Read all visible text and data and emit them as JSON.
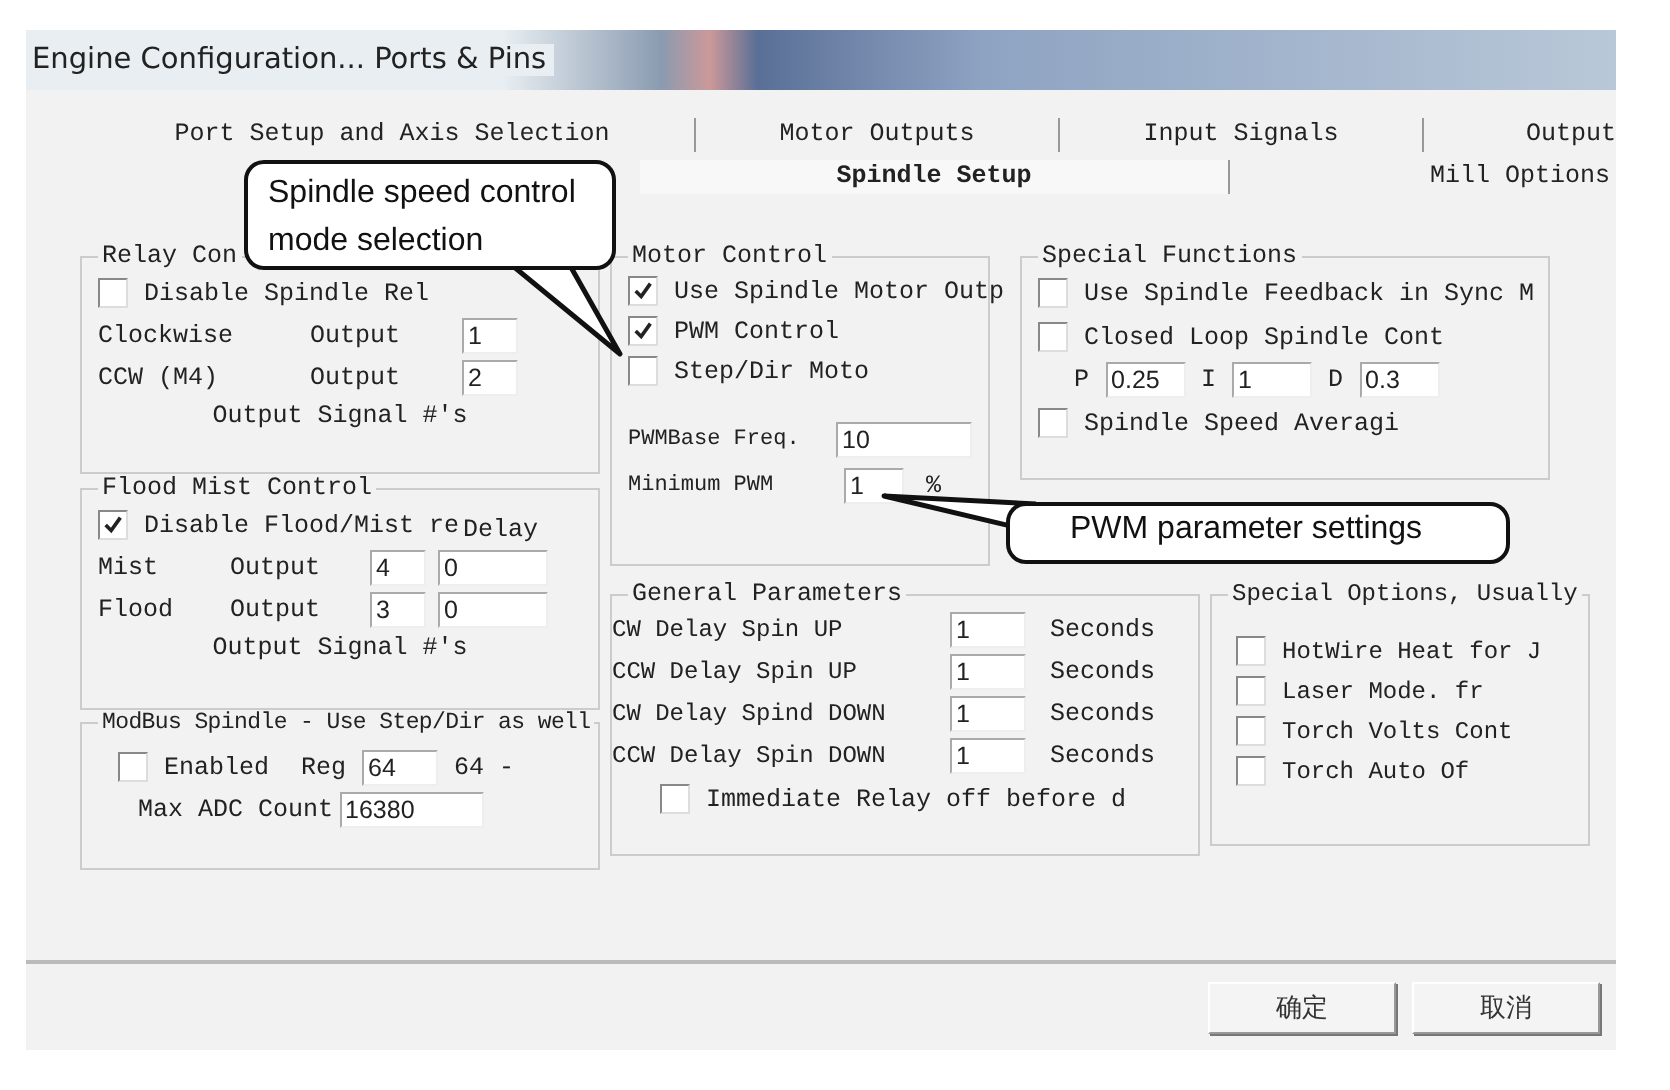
{
  "window": {
    "title": "Engine Configuration... Ports & Pins"
  },
  "tabs": [
    [
      {
        "label": "Port Setup and Axis Selection",
        "selected": false
      },
      {
        "label": "Motor Outputs",
        "selected": false
      },
      {
        "label": "Input Signals",
        "selected": false
      },
      {
        "label": "Output",
        "selected": false
      }
    ],
    [
      {
        "label": "Spindle Setup",
        "selected": true
      },
      {
        "label": "Mill Options",
        "selected": false
      }
    ]
  ],
  "relay_control": {
    "title": "Relay Con",
    "disable": {
      "label": "Disable Spindle Rel",
      "checked": false
    },
    "outputs": [
      {
        "name": "Clockwise",
        "label": "Output",
        "value": "1"
      },
      {
        "name": "CCW (M4)",
        "label": "Output",
        "value": "2"
      }
    ],
    "footer": "Output Signal #'s"
  },
  "flood_mist": {
    "title": "Flood Mist Control",
    "disable": {
      "label": "Disable Flood/Mist re",
      "checked": true
    },
    "delay_heading": "Delay",
    "outputs": [
      {
        "name": "Mist",
        "label": "Output",
        "value": "4",
        "delay": "0"
      },
      {
        "name": "Flood",
        "label": "Output",
        "value": "3",
        "delay": "0"
      }
    ],
    "footer": "Output Signal #'s"
  },
  "modbus": {
    "title": "ModBus Spindle - Use Step/Dir as well",
    "enabled": {
      "label": "Enabled",
      "checked": false
    },
    "reg_label": "Reg",
    "reg_value": "64",
    "reg_suffix": "64 -",
    "max_adc_label": "Max ADC Count",
    "max_adc_value": "16380"
  },
  "motor_control": {
    "title": "Motor Control",
    "options": [
      {
        "label": "Use Spindle Motor Outp",
        "checked": true
      },
      {
        "label": "PWM Control",
        "checked": true
      },
      {
        "label": "Step/Dir Moto",
        "checked": false
      }
    ],
    "fields": [
      {
        "label": "PWMBase Freq.",
        "value": "10"
      },
      {
        "label": "Minimum PWM",
        "value": "1",
        "unit": "%"
      }
    ]
  },
  "special_functions": {
    "title": "Special Functions",
    "options": [
      {
        "label": "Use Spindle Feedback in Sync M",
        "checked": false
      },
      {
        "label": "Closed Loop Spindle Cont",
        "checked": false
      }
    ],
    "pid": [
      {
        "label": "P",
        "value": "0.25"
      },
      {
        "label": "I",
        "value": "1"
      },
      {
        "label": "D",
        "value": "0.3"
      }
    ],
    "averaging": {
      "label": "Spindle Speed Averagi",
      "checked": false
    }
  },
  "general_parameters": {
    "title": "General Parameters",
    "delays": [
      {
        "label": "CW Delay Spin UP",
        "value": "1",
        "unit": "Seconds"
      },
      {
        "label": "CCW Delay Spin UP",
        "value": "1",
        "unit": "Seconds"
      },
      {
        "label": "CW Delay Spind DOWN",
        "value": "1",
        "unit": "Seconds"
      },
      {
        "label": "CCW Delay Spin DOWN",
        "value": "1",
        "unit": "Seconds"
      }
    ],
    "immediate": {
      "label": "Immediate Relay off before d",
      "checked": false
    }
  },
  "special_options": {
    "title": "Special Options, Usually",
    "options": [
      {
        "label": "HotWire Heat for J",
        "checked": false
      },
      {
        "label": "Laser Mode. fr",
        "checked": false
      },
      {
        "label": "Torch Volts Cont",
        "checked": false
      },
      {
        "label": "Torch Auto Of",
        "checked": false
      }
    ]
  },
  "buttons": [
    "确定",
    "取消"
  ],
  "callouts": [
    {
      "text": "Spindle speed control mode selection"
    },
    {
      "text": "PWM parameter settings"
    }
  ]
}
